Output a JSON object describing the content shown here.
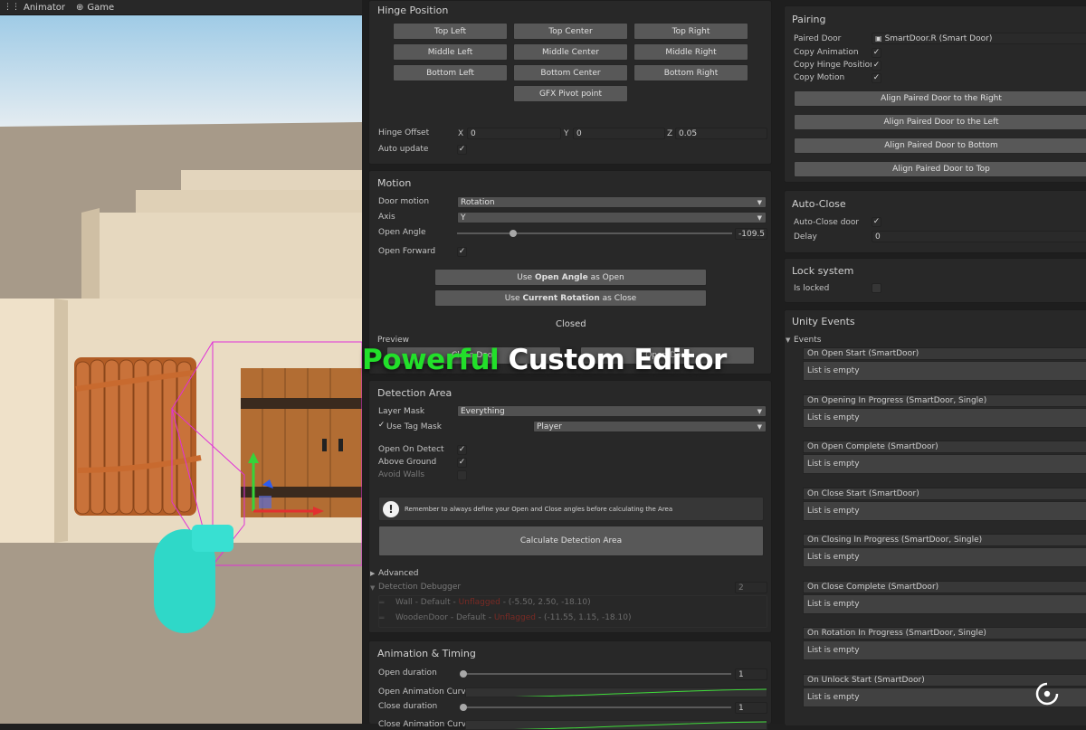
{
  "tabs": [
    {
      "label": "Animator",
      "icon": "animator-icon"
    },
    {
      "label": "Game",
      "icon": "gamepad-icon"
    }
  ],
  "hinge": {
    "title": "Hinge Position",
    "buttons": [
      "Top Left",
      "Top Center",
      "Top Right",
      "Middle Left",
      "Middle Center",
      "Middle Right",
      "Bottom Left",
      "Bottom Center",
      "Bottom Right"
    ],
    "gfx_button": "GFX Pivot point",
    "offset_label": "Hinge Offset",
    "x_label": "X",
    "x_value": "0",
    "y_label": "Y",
    "y_value": "0",
    "z_label": "Z",
    "z_value": "0.05",
    "auto_update_label": "Auto update"
  },
  "motion": {
    "title": "Motion",
    "door_motion_label": "Door motion",
    "door_motion_value": "Rotation",
    "axis_label": "Axis",
    "axis_value": "Y",
    "open_angle_label": "Open Angle",
    "open_angle_value": "-109.5",
    "open_forward_label": "Open Forward",
    "use_open_pre": "Use ",
    "use_open_bold": "Open Angle",
    "use_open_post": " as Open",
    "use_close_pre": "Use ",
    "use_close_bold": "Current Rotation",
    "use_close_post": " as Close",
    "state": "Closed",
    "preview_label": "Preview",
    "preview_btn_left": "Close Door",
    "preview_btn_right": "Open Door"
  },
  "overlay": {
    "word1": "Powerful",
    "word2": "Custom Editor",
    "accent": "#22e02a"
  },
  "detection": {
    "title": "Detection Area",
    "layer_mask_label": "Layer Mask",
    "layer_mask_value": "Everything",
    "use_tag_label": "Use Tag Mask",
    "tag_value": "Player",
    "open_on_detect_label": "Open On Detect",
    "above_ground_label": "Above Ground",
    "avoid_walls_label": "Avoid Walls",
    "warning": "Remember to always define your Open and Close angles before calculating the Area",
    "calc_button": "Calculate Detection Area",
    "advanced_label": "Advanced",
    "debugger_label": "Detection Debugger",
    "debugger_count": "2",
    "rows": [
      {
        "pre": "Wall - Default - ",
        "status": "Unflagged",
        "post": " - (-5.50, 2.50, -18.10)"
      },
      {
        "pre": "WoodenDoor - Default - ",
        "status": "Unflagged",
        "post": " - (-11.55, 1.15, -18.10)"
      }
    ]
  },
  "animation": {
    "title": "Animation & Timing",
    "open_duration_label": "Open duration",
    "open_duration_value": "1",
    "open_curve_label": "Open Animation Curve",
    "close_duration_label": "Close duration",
    "close_duration_value": "1",
    "close_curve_label": "Close Animation Curve"
  },
  "pairing": {
    "title": "Pairing",
    "paired_door_label": "Paired Door",
    "paired_door_value": "SmartDoor.R (Smart Door)",
    "copy_animation_label": "Copy Animation",
    "copy_hinge_label": "Copy Hinge Position",
    "copy_motion_label": "Copy Motion",
    "buttons": [
      "Align Paired Door to the Right",
      "Align Paired Door to the Left",
      "Align Paired Door to Bottom",
      "Align Paired Door to Top"
    ]
  },
  "autoclose": {
    "title": "Auto-Close",
    "door_label": "Auto-Close door",
    "delay_label": "Delay",
    "delay_value": "0"
  },
  "lock": {
    "title": "Lock system",
    "locked_label": "Is locked"
  },
  "events": {
    "title": "Unity Events",
    "foldout_label": "Events",
    "empty_text": "List is empty",
    "items": [
      "On Open Start (SmartDoor)",
      "On Opening In Progress (SmartDoor, Single)",
      "On Open Complete (SmartDoor)",
      "On Close Start (SmartDoor)",
      "On Closing In Progress (SmartDoor, Single)",
      "On Close Complete (SmartDoor)",
      "On Rotation In Progress (SmartDoor, Single)",
      "On Unlock Start (SmartDoor)"
    ]
  }
}
